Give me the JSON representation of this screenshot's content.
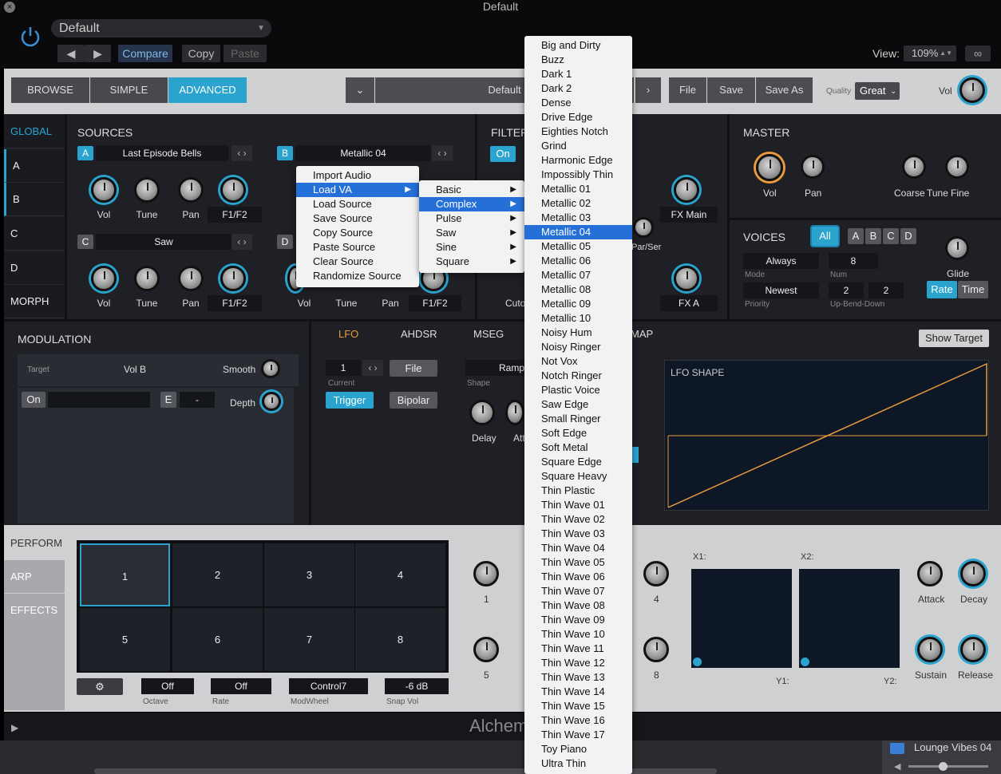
{
  "window": {
    "title": "Default",
    "close_icon": "close-x-icon"
  },
  "header": {
    "preset": "Default",
    "compare": "Compare",
    "copy": "Copy",
    "paste": "Paste",
    "view_label": "View:",
    "view_value": "109%"
  },
  "modes": [
    "BROWSE",
    "SIMPLE",
    "ADVANCED"
  ],
  "preset_bar": {
    "name": "Default",
    "file": "File",
    "save": "Save",
    "save_as": "Save As",
    "quality_label": "Quality",
    "quality": "Great",
    "vol_label": "Vol"
  },
  "sidebar": [
    "GLOBAL",
    "A",
    "B",
    "C",
    "D",
    "MORPH"
  ],
  "sources": {
    "title": "SOURCES",
    "a": {
      "badge": "A",
      "name": "Last Episode Bells"
    },
    "b": {
      "badge": "B",
      "name": "Metallic 04"
    },
    "c": {
      "badge": "C",
      "name": "Saw"
    },
    "d": {
      "badge": "D"
    },
    "knobs": [
      "Vol",
      "Tune",
      "Pan"
    ],
    "filter_sel": "F1/F2"
  },
  "filter": {
    "title": "FILTER",
    "on": "On",
    "fx_main": "FX Main",
    "fx_a": "FX A",
    "par_ser": "Par/Ser",
    "cutoff": "Cuto"
  },
  "master": {
    "title": "MASTER",
    "vol": "Vol",
    "pan": "Pan",
    "coarse": "Coarse",
    "tune": "Tune",
    "fine": "Fine"
  },
  "voices": {
    "title": "VOICES",
    "all": "All",
    "letters": [
      "A",
      "B",
      "C",
      "D"
    ],
    "glide": "Glide",
    "mode": "Always",
    "mode_label": "Mode",
    "num": "8",
    "num_label": "Num",
    "priority": "Newest",
    "priority_label": "Priority",
    "up": "2",
    "down": "2",
    "bend_label": "Up-Bend-Down",
    "rate": "Rate",
    "time": "Time"
  },
  "modulation": {
    "title": "MODULATION",
    "target_label": "Target",
    "target": "Vol B",
    "smooth": "Smooth",
    "on": "On",
    "e": "E",
    "dash": "-",
    "depth": "Depth"
  },
  "lfo": {
    "tabs": [
      "LFO",
      "AHDSR",
      "MSEG",
      "MAP"
    ],
    "show_target": "Show Target",
    "num": "1",
    "current": "Current",
    "file": "File",
    "ramp": "Ramp",
    "shape": "Shape",
    "trigger": "Trigger",
    "bipolar": "Bipolar",
    "delay": "Delay",
    "att": "Att",
    "shape_title": "LFO SHAPE"
  },
  "perform": {
    "tabs": [
      "PERFORM",
      "ARP",
      "EFFECTS"
    ],
    "pads": [
      "1",
      "2",
      "3",
      "4",
      "5",
      "6",
      "7",
      "8"
    ],
    "octave": "Off",
    "octave_label": "Octave",
    "rate": "Off",
    "rate_label": "Rate",
    "modwheel": "Control7",
    "modwheel_label": "ModWheel",
    "snapvol": "-6 dB",
    "snapvol_label": "Snap Vol",
    "knob_labels": [
      "1",
      "4",
      "5",
      "8"
    ],
    "x1": "X1:",
    "x2": "X2:",
    "y1": "Y1:",
    "y2": "Y2:",
    "env": [
      "Attack",
      "Decay",
      "Sustain",
      "Release"
    ]
  },
  "footer": {
    "brand": "Alchem"
  },
  "daw": {
    "track": "Lounge Vibes 04"
  },
  "context_menu": [
    "Import Audio",
    "Load VA",
    "Load Source",
    "Save Source",
    "Copy Source",
    "Paste Source",
    "Clear Source",
    "Randomize Source"
  ],
  "va_menu": [
    "Basic",
    "Complex",
    "Pulse",
    "Saw",
    "Sine",
    "Square"
  ],
  "complex_menu": [
    "Big and Dirty",
    "Buzz",
    "Dark 1",
    "Dark 2",
    "Dense",
    "Drive Edge",
    "Eighties Notch",
    "Grind",
    "Harmonic Edge",
    "Impossibly Thin",
    "Metallic 01",
    "Metallic 02",
    "Metallic 03",
    "Metallic 04",
    "Metallic 05",
    "Metallic 06",
    "Metallic 07",
    "Metallic 08",
    "Metallic 09",
    "Metallic 10",
    "Noisy Hum",
    "Noisy Ringer",
    "Not Vox",
    "Notch Ringer",
    "Plastic Voice",
    "Saw Edge",
    "Small Ringer",
    "Soft Edge",
    "Soft Metal",
    "Square Edge",
    "Square Heavy",
    "Thin Plastic",
    "Thin Wave 01",
    "Thin Wave 02",
    "Thin Wave 03",
    "Thin Wave 04",
    "Thin Wave 05",
    "Thin Wave 06",
    "Thin Wave 07",
    "Thin Wave 08",
    "Thin Wave 09",
    "Thin Wave 10",
    "Thin Wave 11",
    "Thin Wave 12",
    "Thin Wave 13",
    "Thin Wave 14",
    "Thin Wave 15",
    "Thin Wave 16",
    "Thin Wave 17",
    "Toy Piano",
    "Ultra Thin"
  ]
}
